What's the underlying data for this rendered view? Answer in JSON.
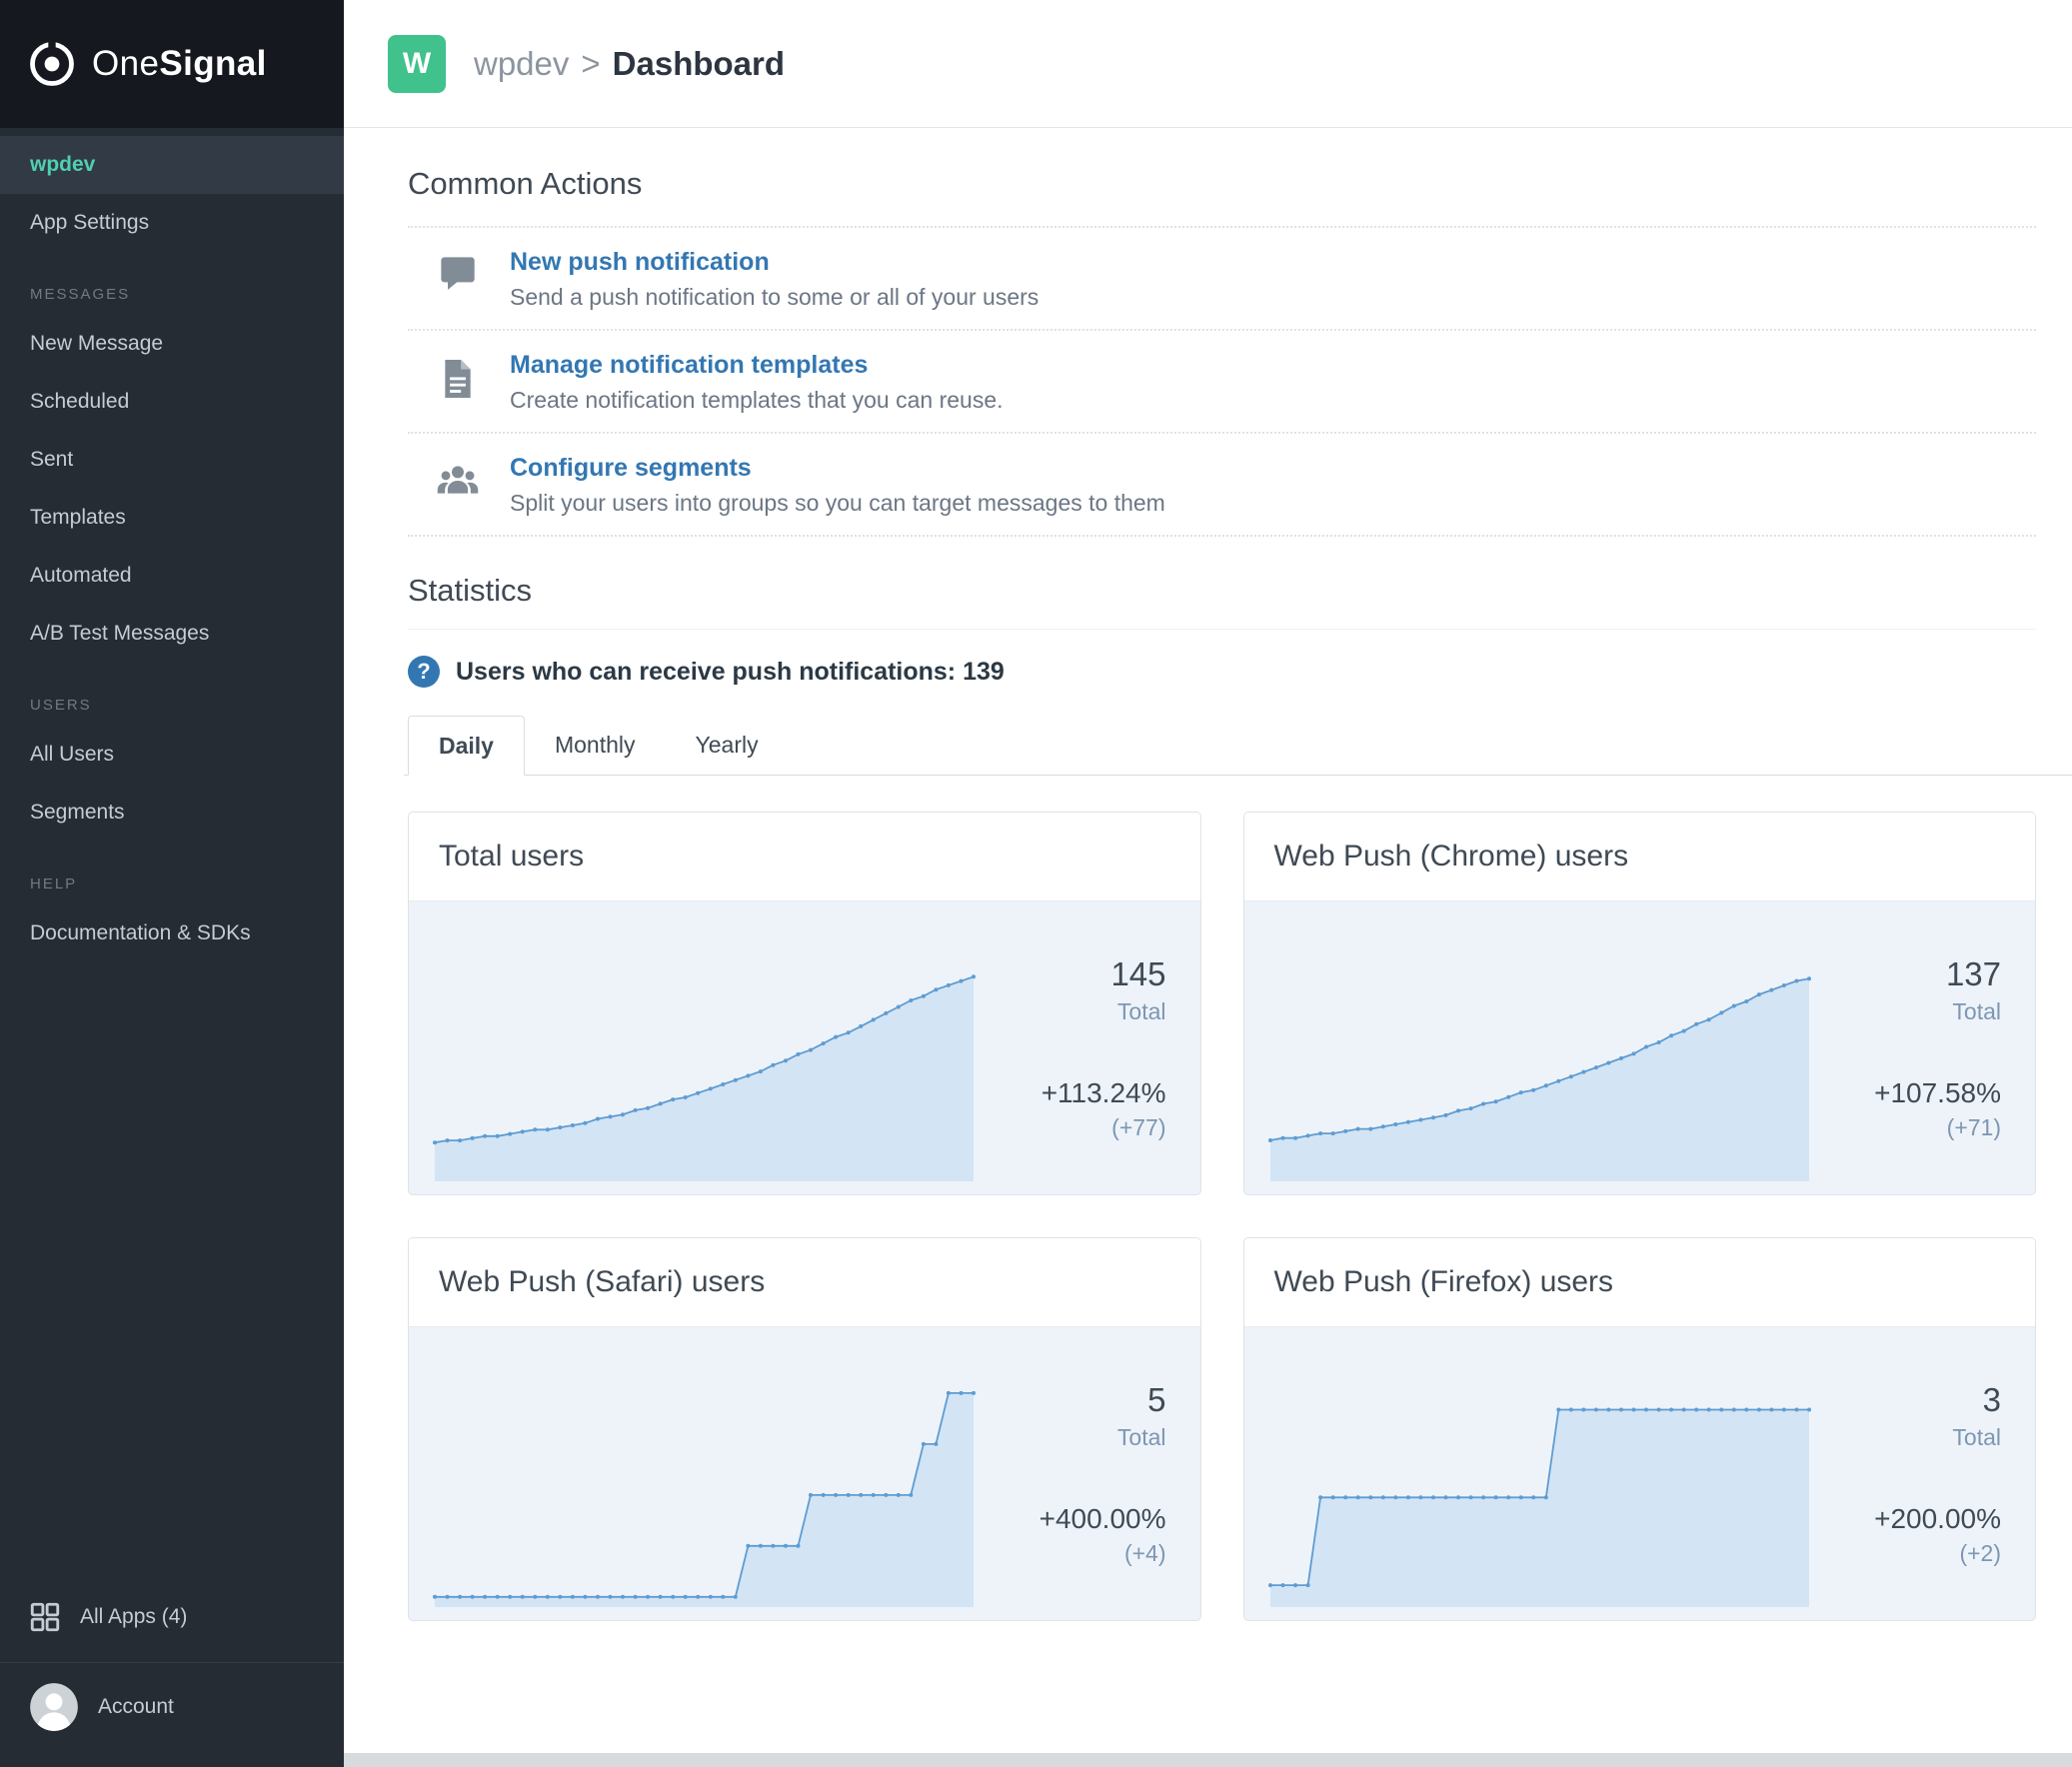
{
  "brand": {
    "logo_text_light": "One",
    "logo_text_bold": "Signal"
  },
  "header": {
    "app_initial": "W",
    "app_name": "wpdev",
    "separator": ">",
    "page_title": "Dashboard"
  },
  "sidebar": {
    "active_app": "wpdev",
    "app_settings": "App Settings",
    "sections": [
      {
        "heading": "MESSAGES",
        "items": [
          "New Message",
          "Scheduled",
          "Sent",
          "Templates",
          "Automated",
          "A/B Test Messages"
        ]
      },
      {
        "heading": "USERS",
        "items": [
          "All Users",
          "Segments"
        ]
      },
      {
        "heading": "HELP",
        "items": [
          "Documentation & SDKs"
        ]
      }
    ],
    "footer": {
      "all_apps_label": "All Apps (4)",
      "account_label": "Account"
    }
  },
  "common_actions": {
    "title": "Common Actions",
    "items": [
      {
        "icon": "speech-bubble-icon",
        "label": "New push notification",
        "description": "Send a push notification to some or all of your users"
      },
      {
        "icon": "document-icon",
        "label": "Manage notification templates",
        "description": "Create notification templates that you can reuse."
      },
      {
        "icon": "people-icon",
        "label": "Configure segments",
        "description": "Split your users into groups so you can target messages to them"
      }
    ]
  },
  "statistics": {
    "title": "Statistics",
    "help_glyph": "?",
    "push_users_text": "Users who can receive push notifications: 139",
    "tabs": [
      {
        "label": "Daily",
        "active": true
      },
      {
        "label": "Monthly",
        "active": false
      },
      {
        "label": "Yearly",
        "active": false
      }
    ]
  },
  "colors": {
    "accent_teal": "#4ecfb2",
    "link_blue": "#3377b2",
    "app_tile_green": "#41c18c",
    "chart_line": "#5e9cd2",
    "chart_fill": "#d3e4f5"
  },
  "chart_data": [
    {
      "type": "area",
      "title": "Total users",
      "total": 145,
      "total_label": "Total",
      "change_pct": "+113.24%",
      "change_abs": "(+77)",
      "ylim": [
        50,
        160
      ],
      "values": [
        68,
        69,
        69,
        70,
        71,
        71,
        72,
        73,
        74,
        74,
        75,
        76,
        77,
        79,
        80,
        81,
        83,
        84,
        86,
        88,
        89,
        91,
        93,
        95,
        97,
        99,
        101,
        104,
        106,
        109,
        111,
        114,
        117,
        119,
        122,
        125,
        128,
        131,
        134,
        136,
        139,
        141,
        143,
        145
      ]
    },
    {
      "type": "area",
      "title": "Web Push (Chrome) users",
      "total": 137,
      "total_label": "Total",
      "change_pct": "+107.58%",
      "change_abs": "(+71)",
      "ylim": [
        48,
        152
      ],
      "values": [
        66,
        67,
        67,
        68,
        69,
        69,
        70,
        71,
        71,
        72,
        73,
        74,
        75,
        76,
        77,
        79,
        80,
        82,
        83,
        85,
        87,
        88,
        90,
        92,
        94,
        96,
        98,
        100,
        102,
        104,
        107,
        109,
        112,
        114,
        117,
        119,
        122,
        125,
        127,
        130,
        132,
        134,
        136,
        137
      ]
    },
    {
      "type": "area",
      "title": "Web Push (Safari) users",
      "total": 5,
      "total_label": "Total",
      "change_pct": "+400.00%",
      "change_abs": "(+4)",
      "ylim": [
        0.8,
        5.45
      ],
      "values": [
        1,
        1,
        1,
        1,
        1,
        1,
        1,
        1,
        1,
        1,
        1,
        1,
        1,
        1,
        1,
        1,
        1,
        1,
        1,
        1,
        1,
        1,
        1,
        1,
        1,
        2,
        2,
        2,
        2,
        2,
        3,
        3,
        3,
        3,
        3,
        3,
        3,
        3,
        3,
        4,
        4,
        5,
        5,
        5
      ]
    },
    {
      "type": "area",
      "title": "Web Push (Firefox) users",
      "total": 3,
      "total_label": "Total",
      "change_pct": "+200.00%",
      "change_abs": "(+2)",
      "ylim": [
        0.75,
        3.45
      ],
      "values": [
        1,
        1,
        1,
        1,
        2,
        2,
        2,
        2,
        2,
        2,
        2,
        2,
        2,
        2,
        2,
        2,
        2,
        2,
        2,
        2,
        2,
        2,
        2,
        3,
        3,
        3,
        3,
        3,
        3,
        3,
        3,
        3,
        3,
        3,
        3,
        3,
        3,
        3,
        3,
        3,
        3,
        3,
        3,
        3
      ]
    }
  ]
}
